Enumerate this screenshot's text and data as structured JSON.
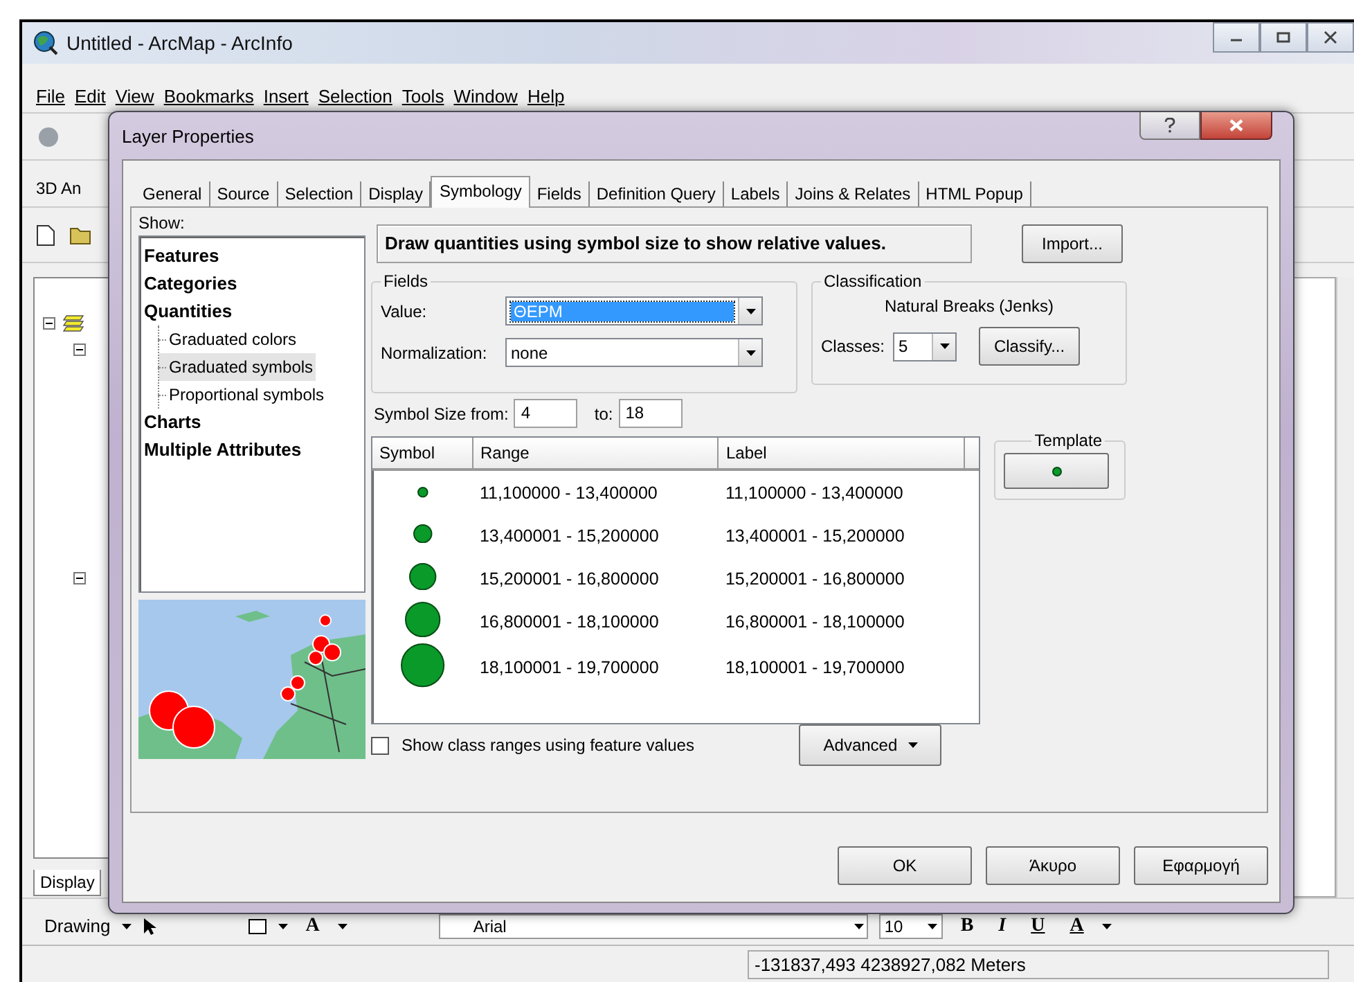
{
  "window": {
    "title": "Untitled - ArcMap - ArcInfo"
  },
  "menu": [
    "File",
    "Edit",
    "View",
    "Bookmarks",
    "Insert",
    "Selection",
    "Tools",
    "Window",
    "Help"
  ],
  "toolbar_label": "3D An",
  "toc_tab": "Display",
  "drawing_toolbar": {
    "label": "Drawing",
    "text_tool": "A",
    "font": "Arial",
    "size": "10",
    "bold": "B",
    "italic": "I",
    "underline": "U",
    "font_color": "A"
  },
  "status_bar": {
    "coordinates": "-131837,493  4238927,082 Meters"
  },
  "dialog": {
    "title": "Layer Properties",
    "tabs": [
      {
        "label": "General",
        "selected": false
      },
      {
        "label": "Source",
        "selected": false
      },
      {
        "label": "Selection",
        "selected": false
      },
      {
        "label": "Display",
        "selected": false
      },
      {
        "label": "Symbology",
        "selected": true
      },
      {
        "label": "Fields",
        "selected": false
      },
      {
        "label": "Definition Query",
        "selected": false
      },
      {
        "label": "Labels",
        "selected": false
      },
      {
        "label": "Joins & Relates",
        "selected": false
      },
      {
        "label": "HTML Popup",
        "selected": false
      }
    ],
    "show_label": "Show:",
    "show_tree": [
      {
        "label": "Features",
        "selected": false
      },
      {
        "label": "Categories",
        "selected": false
      },
      {
        "label": "Quantities",
        "selected": false,
        "children": [
          {
            "label": "Graduated colors",
            "selected": false
          },
          {
            "label": "Graduated symbols",
            "selected": true
          },
          {
            "label": "Proportional symbols",
            "selected": false
          }
        ]
      },
      {
        "label": "Charts",
        "selected": false
      },
      {
        "label": "Multiple Attributes",
        "selected": false
      }
    ],
    "description": "Draw quantities using symbol size to show relative values.",
    "import_button": "Import...",
    "fields": {
      "title": "Fields",
      "value_label": "Value:",
      "value": "ΘΕΡΜ",
      "normalization_label": "Normalization:",
      "normalization": "none"
    },
    "classification": {
      "title": "Classification",
      "method": "Natural Breaks (Jenks)",
      "classes_label": "Classes:",
      "classes": "5",
      "classify_button": "Classify..."
    },
    "symbol_size": {
      "from_label": "Symbol Size from:",
      "from": "4",
      "to_label": "to:",
      "to": "18"
    },
    "table": {
      "columns": [
        "Symbol",
        "Range",
        "Label"
      ],
      "rows": [
        {
          "range": "11,100000 - 13,400000",
          "label": "11,100000 - 13,400000"
        },
        {
          "range": "13,400001 - 15,200000",
          "label": "13,400001 - 15,200000"
        },
        {
          "range": "15,200001 - 16,800000",
          "label": "15,200001 - 16,800000"
        },
        {
          "range": "16,800001 - 18,100000",
          "label": "16,800001 - 18,100000"
        },
        {
          "range": "18,100001 - 19,700000",
          "label": "18,100001 - 19,700000"
        }
      ]
    },
    "template": {
      "title": "Template"
    },
    "show_class_ranges": {
      "label": "Show class ranges using feature values",
      "checked": false
    },
    "advanced_button": "Advanced",
    "buttons": [
      "OK",
      "Άκυρο",
      "Εφαρμογή"
    ]
  }
}
